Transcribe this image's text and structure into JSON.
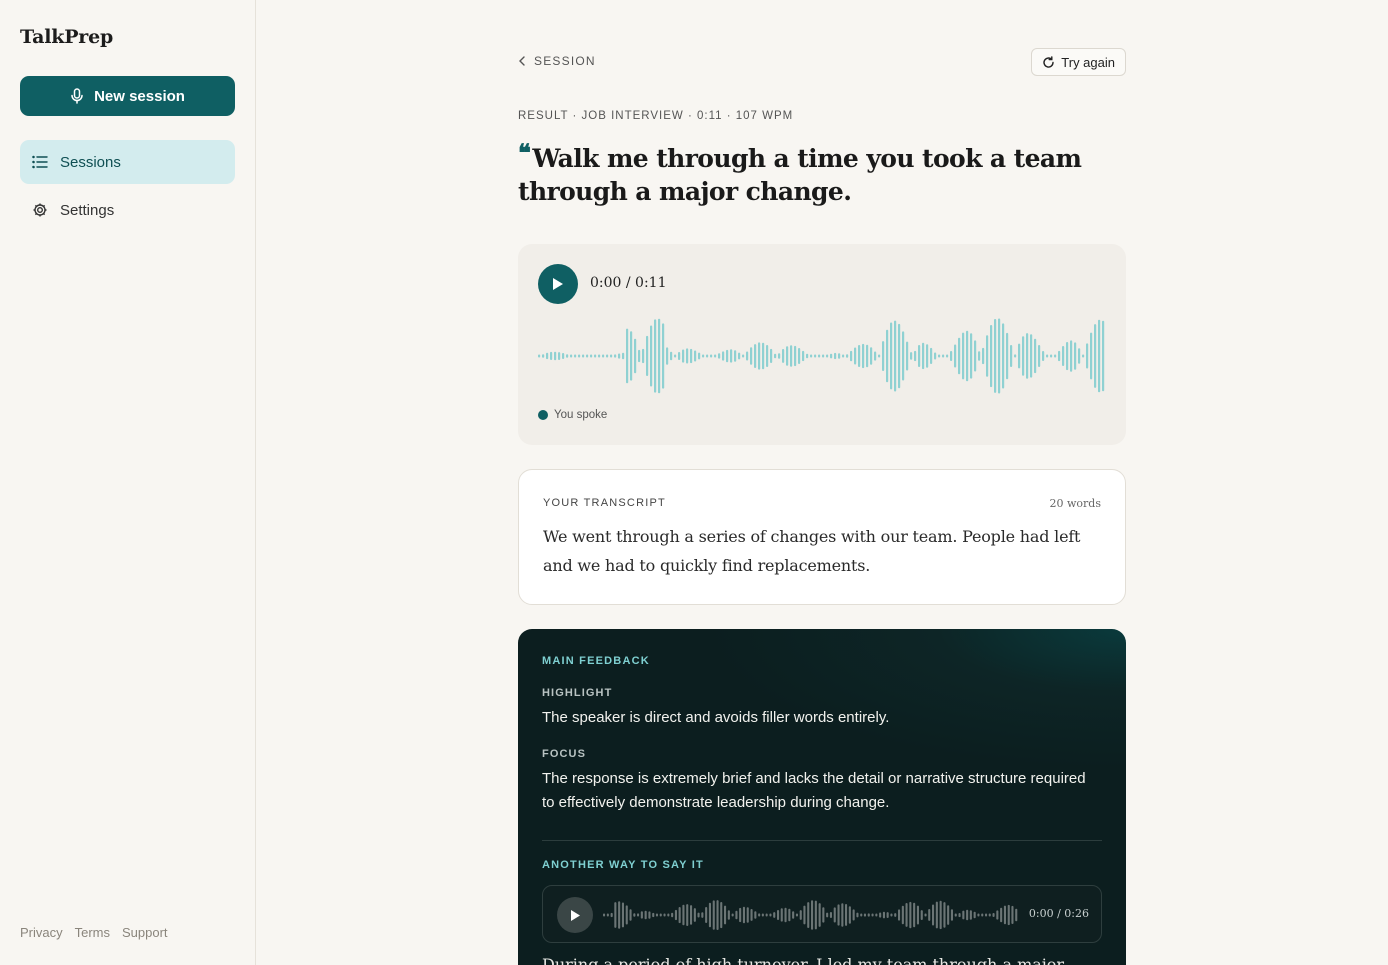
{
  "sidebar": {
    "brand": "TalkPrep",
    "new_session_label": "New session",
    "items": [
      {
        "label": "Sessions",
        "active": true
      },
      {
        "label": "Settings",
        "active": false
      }
    ],
    "footer": [
      "Privacy",
      "Terms",
      "Support"
    ]
  },
  "header": {
    "back_label": "SESSION",
    "try_again_label": "Try again"
  },
  "result": {
    "meta": "RESULT · JOB INTERVIEW · 0:11 · 107 WPM",
    "question": "Walk me through a time you took a team through a major change."
  },
  "player": {
    "time": "0:00 / 0:11",
    "legend": "You spoke"
  },
  "transcript": {
    "label": "YOUR TRANSCRIPT",
    "count": "20 words",
    "text": "We went through a series of changes with our team. People had left and we had to quickly find replacements."
  },
  "feedback": {
    "title": "MAIN FEEDBACK",
    "highlight_label": "HIGHLIGHT",
    "highlight_text": "The speaker is direct and avoids filler words entirely.",
    "focus_label": "FOCUS",
    "focus_text": "The response is extremely brief and lacks the detail or narrative structure required to effectively demonstrate leadership during change.",
    "alt_title": "ANOTHER WAY TO SAY IT",
    "alt_time": "0:00 / 0:26",
    "alt_text_partial": "During a period of high turnover, I led my team through a major"
  },
  "colors": {
    "accent": "#0f5f63",
    "wave": "#8fd1d2",
    "wave_dark": "#6b7575",
    "active_nav": "#d3ecee"
  }
}
